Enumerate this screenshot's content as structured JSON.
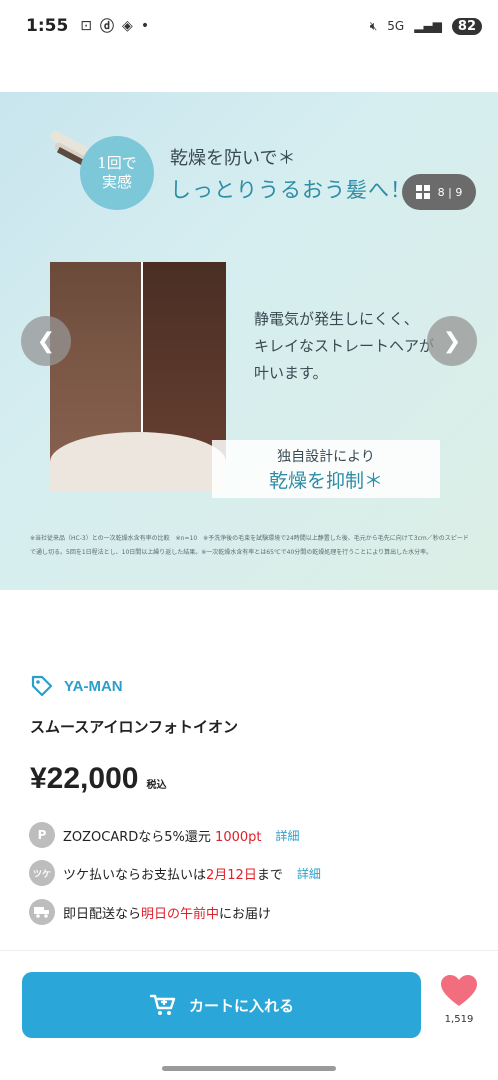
{
  "status_bar": {
    "time": "1:55",
    "network": "5G",
    "battery": "82"
  },
  "carousel": {
    "counter": "8 | 9",
    "badge_line1": "1回で",
    "badge_line2": "実感",
    "headline1": "乾燥を防いで＊",
    "headline2": "しっとりうるおう髪へ！",
    "desc_line1": "静電気が発生しにくく、",
    "desc_line2": "キレイなストレートヘアが",
    "desc_line3": "叶います。",
    "callout_line1": "独自設計により",
    "callout_line2": "乾燥を抑制＊",
    "footnote": "※当社従来品（HC-3）との一次乾燥水含有率の比較　※n=10　※予洗浄後の毛束を試験環境で24時間以上静置した後、毛元から毛先に向けて3cm／秒のスピードで通し切る。5回を1日程法とし、10日間以上繰り返した結果。※一次乾燥水含有率とは65℃で40分間の乾燥処理を行うことにより算出した水分率。"
  },
  "product": {
    "brand": "YA-MAN",
    "name": "スムースアイロンフォトイオン",
    "price": "¥22,000",
    "tax_label": "税込"
  },
  "benefits": [
    {
      "icon": "P",
      "text_before": "ZOZOCARDなら5%還元 ",
      "highlight": "1000pt",
      "text_after": "",
      "link": "詳細"
    },
    {
      "icon": "ツケ",
      "text_before": "ツケ払いならお支払いは",
      "highlight": "2月12日",
      "text_after": "まで",
      "link": "詳細"
    },
    {
      "icon": "truck",
      "text_before": "即日配送なら",
      "highlight": "明日の午前中",
      "text_after": "にお届け",
      "link": ""
    }
  ],
  "bottom": {
    "cart_label": "カートに入れる",
    "fav_count": "1,519"
  },
  "colors": {
    "accent": "#2aa6d9",
    "brand": "#2b9fc9",
    "highlight_red": "#e0202a",
    "heart": "#f26d7d"
  }
}
